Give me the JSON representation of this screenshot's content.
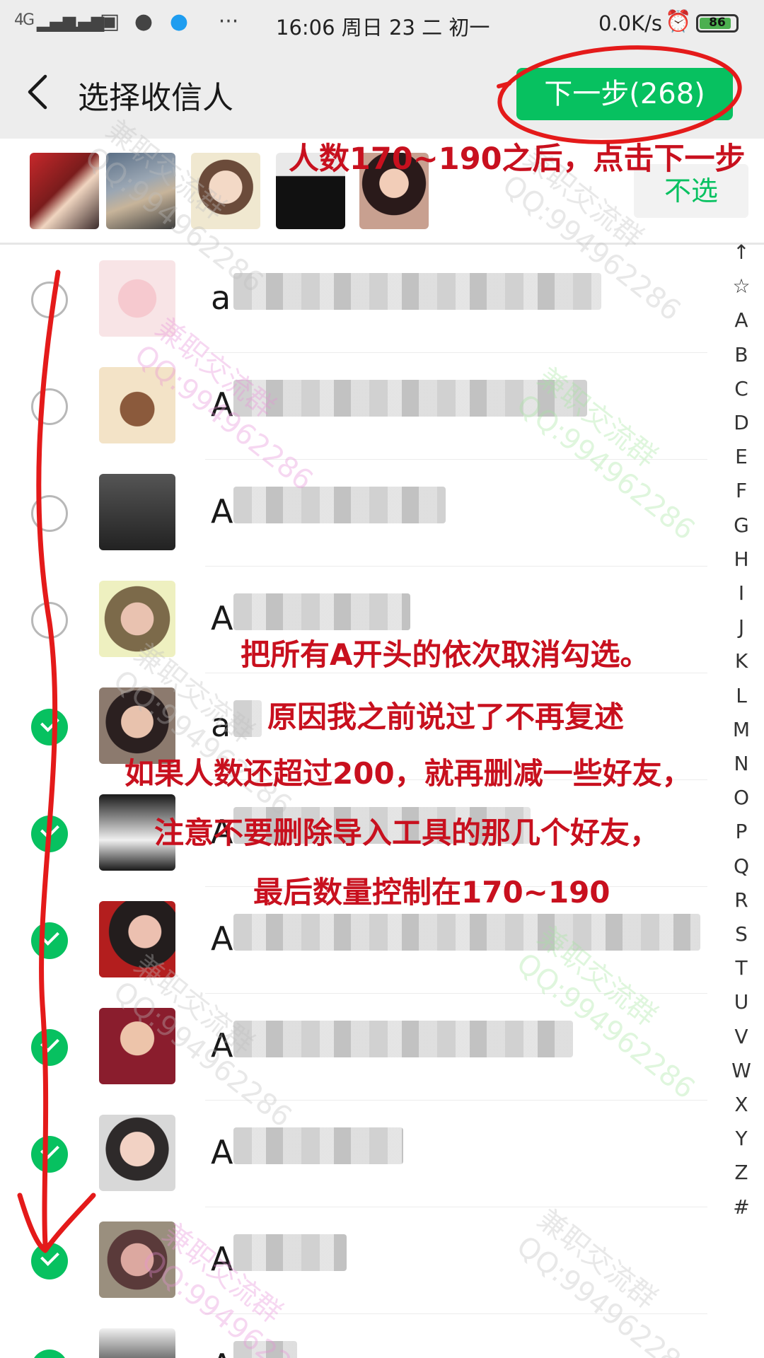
{
  "status_bar": {
    "network": "4G",
    "time": "16:06 周日 23 二 初一",
    "speed": "0.0K/s",
    "battery": "86",
    "more": "···"
  },
  "header": {
    "title": "选择收信人",
    "next_label": "下一步(268)"
  },
  "selected_strip": {
    "deselect_label": "不选"
  },
  "contacts": [
    {
      "initial": "a",
      "checked": false
    },
    {
      "initial": "A",
      "checked": false
    },
    {
      "initial": "A",
      "checked": false
    },
    {
      "initial": "A",
      "checked": false
    },
    {
      "initial": "a",
      "checked": true
    },
    {
      "initial": "A",
      "checked": true
    },
    {
      "initial": "A",
      "checked": true
    },
    {
      "initial": "A",
      "checked": true
    },
    {
      "initial": "A",
      "checked": true
    },
    {
      "initial": "A",
      "checked": true
    },
    {
      "initial": "A",
      "checked": true
    }
  ],
  "index": [
    "↑",
    "☆",
    "A",
    "B",
    "C",
    "D",
    "E",
    "F",
    "G",
    "H",
    "I",
    "J",
    "K",
    "L",
    "M",
    "N",
    "O",
    "P",
    "Q",
    "R",
    "S",
    "T",
    "U",
    "V",
    "W",
    "X",
    "Y",
    "Z",
    "#"
  ],
  "annotations": {
    "top_note": "人数170~190之后，点击下一步",
    "line1": "把所有A开头的依次取消勾选。",
    "line2": "原因我之前说过了不再复述",
    "line3": "如果人数还超过200，就再删减一些好友，",
    "line4": "注意不要删除导入工具的那几个好友，",
    "line5": "最后数量控制在170~190"
  },
  "watermark": {
    "line1": "兼职交流群",
    "line2": "QQ:994962286"
  },
  "colors": {
    "accent": "#07c160",
    "annotation": "#c8101e",
    "header_bg": "#ededed"
  }
}
